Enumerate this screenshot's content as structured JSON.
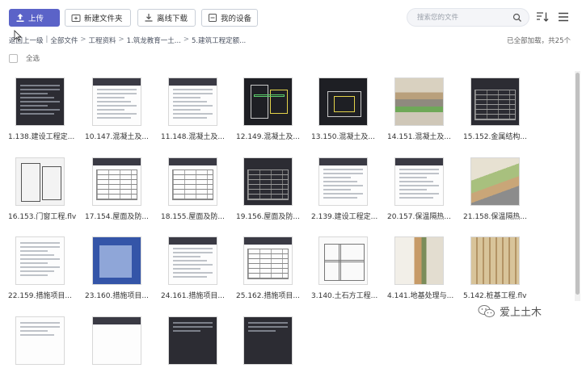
{
  "toolbar": {
    "upload_label": "上传",
    "new_folder_label": "新建文件夹",
    "offline_download_label": "离线下载",
    "my_devices_label": "我的设备",
    "search_placeholder": "搜索您的文件"
  },
  "breadcrumb": {
    "back": "返回上一级",
    "sep": "|",
    "root": "全部文件",
    "items": [
      "工程资料",
      "1.筑龙教育一土...",
      "5.建筑工程定额..."
    ]
  },
  "status_text": "已全部加载，共25个",
  "select_all_label": "全选",
  "files": [
    {
      "label": "1.138.建设工程定..."
    },
    {
      "label": "10.147.混凝土及..."
    },
    {
      "label": "11.148.混凝土及..."
    },
    {
      "label": "12.149.混凝土及..."
    },
    {
      "label": "13.150.混凝土及..."
    },
    {
      "label": "14.151.混凝土及..."
    },
    {
      "label": "15.152.金属结构..."
    },
    {
      "label": "16.153.门窗工程.flv"
    },
    {
      "label": "17.154.屋面及防..."
    },
    {
      "label": "18.155.屋面及防..."
    },
    {
      "label": "19.156.屋面及防..."
    },
    {
      "label": "2.139.建设工程定..."
    },
    {
      "label": "20.157.保温隔热..."
    },
    {
      "label": "21.158.保温隔热..."
    },
    {
      "label": "22.159.措施项目..."
    },
    {
      "label": "23.160.措施项目..."
    },
    {
      "label": "24.161.措施项目..."
    },
    {
      "label": "25.162.措施项目..."
    },
    {
      "label": "3.140.土石方工程..."
    },
    {
      "label": "4.141.地基处理与..."
    },
    {
      "label": "5.142.桩基工程.flv"
    },
    {
      "label": ""
    },
    {
      "label": ""
    },
    {
      "label": ""
    },
    {
      "label": ""
    }
  ],
  "watermark": "爱上土木",
  "colors": {
    "accent": "#5b63c8"
  }
}
